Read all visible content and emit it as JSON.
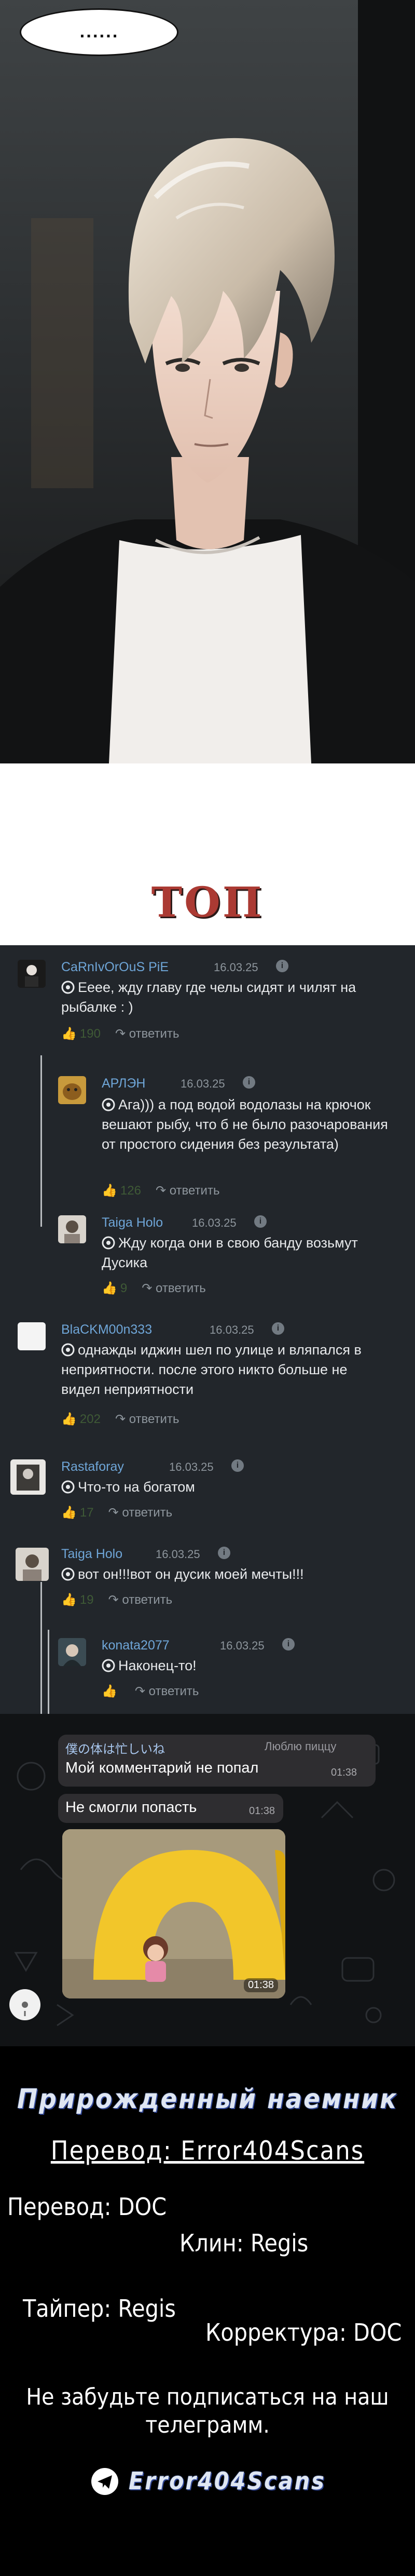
{
  "panel": {
    "speech_bubble": "......"
  },
  "section_title": "ТОП",
  "comments": [
    {
      "user": "CaRnIvOrOuS PiE",
      "date": "16.03.25",
      "text": "Еееe, жду главу где челы сидят и чилят на рыбалке : )",
      "likes": "190",
      "reply": "ответить"
    },
    {
      "user": "АРЛЭН",
      "date": "16.03.25",
      "text": "Ага))) а под водой водолазы на крючок вешают рыбу, что б не было разочарования от простого сидения без результата)",
      "likes": "126",
      "reply": "ответить"
    },
    {
      "user": "Taiga Holo",
      "date": "16.03.25",
      "text": "Жду когда они в свою банду возьмут Дусика",
      "likes": "9",
      "reply": "ответить"
    },
    {
      "user": "BlaCKM00n333",
      "date": "16.03.25",
      "text": "однажды иджин шел по улице и вляпался в неприятности. после этого никто больше не видел неприятности",
      "likes": "202",
      "reply": "ответить"
    },
    {
      "user": "Rastaforay",
      "date": "16.03.25",
      "text": "Что-то на богатом",
      "likes": "17",
      "reply": "ответить"
    },
    {
      "user": "Taiga Holo",
      "date": "16.03.25",
      "text": "вот он!!!вот он дусик моей мечты!!!",
      "likes": "19",
      "reply": "ответить"
    },
    {
      "user": "konata2077",
      "date": "16.03.25",
      "text": "Наконец-то!",
      "likes": "",
      "reply": "ответить"
    }
  ],
  "chat": {
    "sender": "僕の体は忙しいね",
    "tag": "Люблю пиццу",
    "msg1": "Мой комментарий не попал",
    "time1": "01:38",
    "msg2": "Не смогли попасть",
    "time2": "01:38",
    "time3": "01:38"
  },
  "credits": {
    "title": "Прирожденный наемник",
    "team": "Перевод: Error404Scans",
    "translate": "Перевод: DOC",
    "clean": "Клин: Regis",
    "typer": "Тайпер: Regis",
    "proof": "Корректура: DOC",
    "subscribe_line1": "Не забудьте подписаться на наш",
    "subscribe_line2": "телеграмм.",
    "channel": "Error404Scans"
  },
  "colors": {
    "title_red": "#ab3a33",
    "comment_bg": "#22262b",
    "username_blue": "#6fa6d8",
    "like_green": "#4c7a3f"
  }
}
